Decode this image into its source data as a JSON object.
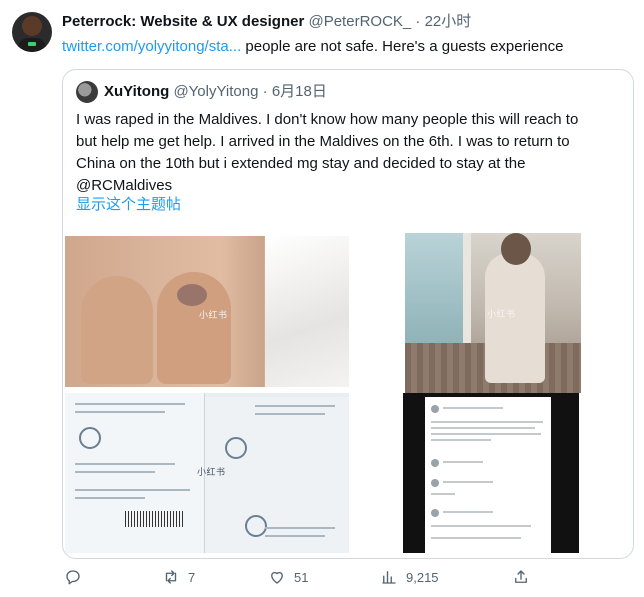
{
  "tweet": {
    "author_name": "Peterrock: Website & UX designer",
    "handle": "@PeterROCK_",
    "separator": "·",
    "time": "22小时",
    "link_text": "twitter.com/yolyyitong/sta...",
    "text_after_link": " people are not safe. Here's a guests experience"
  },
  "quoted": {
    "author_name": "XuYitong",
    "handle": "@YolyYitong",
    "separator": "·",
    "date": "6月18日",
    "lines": [
      "I was raped in the Maldives. I don't know how many people this will reach to",
      "but help me get help. I arrived in the Maldives on the 6th. I was to return to",
      "China on the 10th but i extended mg stay and decided to stay at the",
      "@RCMaldives"
    ],
    "show_thread": "显示这个主题帖",
    "watermarks": [
      "小红书",
      "小红书",
      "小红书"
    ]
  },
  "actions": {
    "reply_icon": "reply-icon",
    "retweet_icon": "retweet-icon",
    "retweet_count": "7",
    "like_icon": "heart-icon",
    "like_count": "51",
    "views_icon": "views-icon",
    "views_count": "9,215",
    "share_icon": "share-icon"
  },
  "colors": {
    "link": "#1d9bf0",
    "muted": "#536471",
    "border": "#cfd9de"
  }
}
